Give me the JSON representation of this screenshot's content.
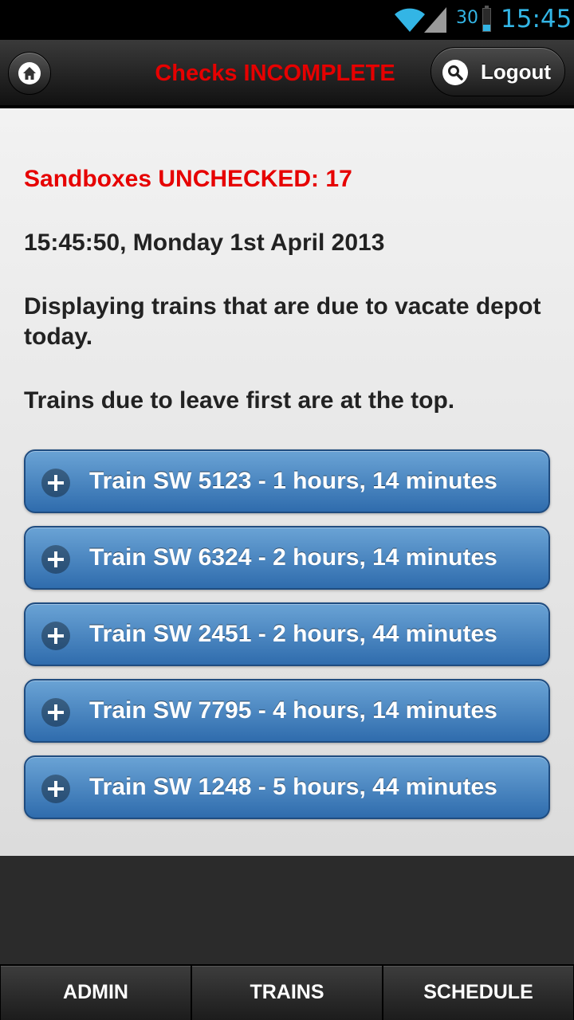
{
  "status_bar": {
    "battery_level": "30",
    "time": "15:45",
    "icons": [
      "wifi-icon",
      "cell-signal-icon",
      "battery-icon"
    ],
    "accent_color": "#33b5e5"
  },
  "header": {
    "title": "Checks INCOMPLETE",
    "title_color": "#e60000",
    "home_icon": "home-icon",
    "logout_label": "Logout",
    "logout_icon": "search-icon"
  },
  "content": {
    "unchecked_text": "Sandboxes UNCHECKED: 17",
    "datetime": "15:45:50, Monday 1st April 2013",
    "description": "Displaying trains that are due to vacate depot today.",
    "order_note": "Trains due to leave first are at the top."
  },
  "trains": [
    {
      "label": "Train SW 5123 - 1 hours, 14 minutes"
    },
    {
      "label": "Train SW 6324 - 2 hours, 14 minutes"
    },
    {
      "label": "Train SW 2451 - 2 hours, 44 minutes"
    },
    {
      "label": "Train SW 7795 - 4 hours, 14 minutes"
    },
    {
      "label": "Train SW 1248 - 5 hours, 44 minutes"
    }
  ],
  "nav": [
    {
      "label": "ADMIN"
    },
    {
      "label": "TRAINS"
    },
    {
      "label": "SCHEDULE"
    }
  ]
}
